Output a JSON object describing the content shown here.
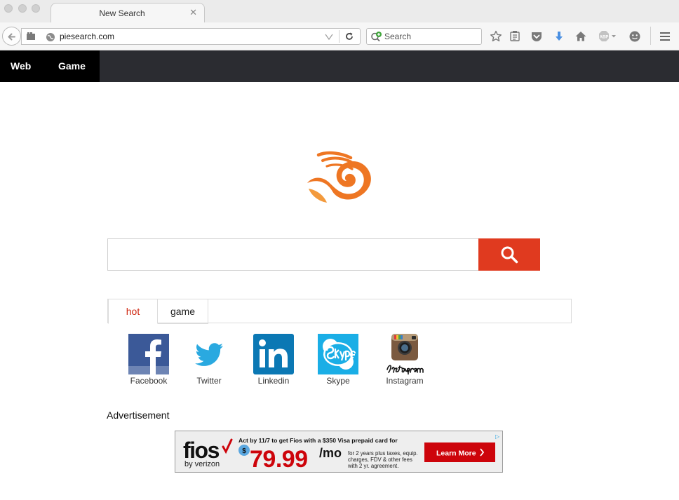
{
  "browser": {
    "tab_title": "New Search",
    "tab_close": "✕",
    "url": "piesearch.com",
    "search_placeholder": "Search",
    "abp_label": "ABP"
  },
  "site_nav": {
    "items": [
      {
        "label": "Web"
      },
      {
        "label": "Game"
      }
    ]
  },
  "search": {
    "value": "",
    "placeholder": ""
  },
  "tabs": [
    {
      "label": "hot",
      "active": true
    },
    {
      "label": "game",
      "active": false
    }
  ],
  "social_links": [
    {
      "label": "Facebook",
      "icon": "facebook-icon"
    },
    {
      "label": "Twitter",
      "icon": "twitter-icon"
    },
    {
      "label": "Linkedin",
      "icon": "linkedin-icon"
    },
    {
      "label": "Skype",
      "icon": "skype-icon"
    },
    {
      "label": "Instagram",
      "icon": "instagram-icon"
    }
  ],
  "ad": {
    "heading": "Advertisement",
    "brand": "fios",
    "byline": "by verizon",
    "headline": "Act by 11/7 to get Fios with a $350 Visa prepaid card for",
    "dollar": "$",
    "price": "79.99",
    "per": "/mo",
    "fine_print_1": "for 2 years plus taxes, equip.",
    "fine_print_2": "charges, FDV & other fees",
    "fine_print_3": "with 2 yr. agreement.",
    "cta": "Learn More",
    "badge": "▷"
  },
  "colors": {
    "accent": "#e03a1f",
    "nav_bg": "#2b2c31",
    "logo_orange": "#ee7623",
    "ad_red": "#cd040b"
  }
}
